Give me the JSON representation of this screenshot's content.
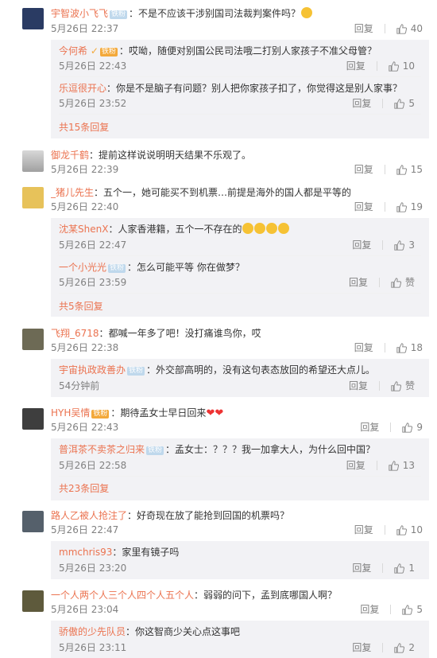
{
  "common": {
    "reply_label": "回复",
    "zan_label": "赞",
    "sep": "："
  },
  "comments": [
    {
      "name": "宇智波小飞飞",
      "badge": "铁粉",
      "text": "不是不应该干涉别国司法裁判案件吗？",
      "time": "5月26日 22:37",
      "likes": "40",
      "replies": [
        {
          "name": "今何希",
          "vip": "铁粉",
          "text": "哎呦，随便对别国公民司法哦二打别人家孩子不准父母管？",
          "time": "5月26日 22:43",
          "likes": "10"
        },
        {
          "name": "乐逗很开心",
          "text": "你是不是脑子有问题？别人把你家孩子扣了，你觉得这是别人家事？",
          "time": "5月26日 23:52",
          "likes": "5"
        }
      ],
      "more": "共15条回复"
    },
    {
      "name": "御龙千鹤",
      "text": "提前这样说说明明天结果不乐观了。",
      "time": "5月26日 22:39",
      "likes": "15",
      "replies": []
    },
    {
      "name": "_猪儿先生",
      "text": "五个一，她可能买不到机票…前提是海外的国人都是平等的",
      "time": "5月26日 22:40",
      "likes": "19",
      "replies": [
        {
          "name": "沈某ShenX",
          "text": "人家香港籍，五个一不存在的",
          "time": "5月26日 22:47",
          "likes": "3"
        },
        {
          "name": "一个小光光",
          "badge": "铁粉",
          "text": "怎么可能平等 你在做梦？",
          "time": "5月26日 23:59",
          "likes": "赞"
        }
      ],
      "more": "共5条回复"
    },
    {
      "name": "飞翔_6718",
      "text": "都喊一年多了吧！没打痛谁鸟你，哎",
      "time": "5月26日 22:38",
      "likes": "18",
      "replies": [
        {
          "name": "宇宙执政政善办",
          "badge": "铁粉",
          "text": "外交部高明的，没有这句表态放回的希望还大点儿。",
          "time": "54分钟前",
          "likes": "赞"
        }
      ]
    },
    {
      "name": "HYH吴情",
      "vip": "铁粉",
      "text": "期待孟女士早日回来",
      "time": "5月26日 22:43",
      "likes": "9",
      "replies": [
        {
          "name": "普洱茶不卖茶之归来",
          "badge": "铁粉",
          "text": "孟女士：？？？我一加拿大人，为什么回中国？",
          "time": "5月26日 22:58",
          "likes": "13"
        }
      ],
      "more": "共23条回复"
    },
    {
      "name": "路人乙被人抢注了",
      "text": "好奇现在放了能抢到回国的机票吗？",
      "time": "5月26日 22:47",
      "likes": "10",
      "replies": [
        {
          "name": "mmchris93",
          "text": "家里有镜子吗",
          "time": "5月26日 23:20",
          "likes": "1"
        }
      ]
    },
    {
      "name": "一个人两个人三个人四个人五个人",
      "text": "弱弱的问下，孟到底哪国人啊？",
      "time": "5月26日 23:04",
      "likes": "5",
      "replies": [
        {
          "name": "骄傲的少先队员",
          "text": "你这智商少关心点这事吧",
          "time": "5月26日 23:11",
          "likes": "2"
        }
      ]
    }
  ],
  "colors": {
    "accent": "#eb7350",
    "meta": "#808080",
    "reply_bg": "#f2f2f5"
  }
}
